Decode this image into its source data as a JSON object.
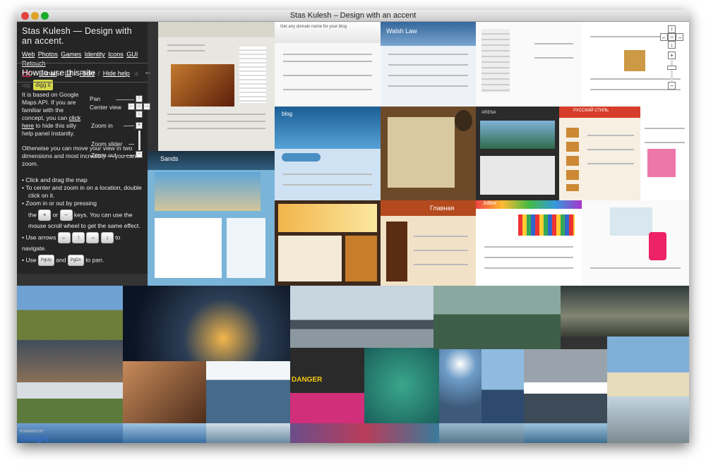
{
  "window": {
    "title": "Stas Kulesh – Design with an accent"
  },
  "panel": {
    "title": "Stas Kulesh — Design with an accent.",
    "links": [
      "Web",
      "Photos",
      "Games",
      "Identity",
      "Icons",
      "GUI",
      "Retouch"
    ],
    "links2": [
      "CV",
      "E-mail",
      "LJ",
      "Flickr",
      "Hide help"
    ],
    "seps": [
      "/",
      "/",
      "/",
      "/"
    ],
    "digg_label": "di ugg",
    "digg_button": "digg it",
    "how_title": "How to use this site",
    "how_close": "←",
    "intro_text": "It is based on Google Maps API. If you are familiar with the concept, you can",
    "click_here": "click here",
    "intro_text_2": "to hide this silly help panel instantly.",
    "otherwise": "Otherwise you can move your view in two dimensions and most incredibly — you can zoom.",
    "labels": {
      "pan": "Pan",
      "center": "Center view",
      "zoom_in": "Zoom in",
      "zoom_slider": "Zoom slider",
      "zoom_out": "Zoom out"
    },
    "bullets": [
      "Click and drag the map",
      "To center and zoom in on a location, double click on it.",
      "Zoom in or out by pressing",
      "Use arrows",
      "Use"
    ],
    "zoom_tail": "keys. You can use the mouse scroll wheel to get the same effect.",
    "the_word": "the",
    "or_word": "or",
    "and_word": "and",
    "to_navigate": "to navigate.",
    "to_pan": "to pan.",
    "keys": {
      "plus": "+",
      "minus": "−",
      "left": "←",
      "up": "↑",
      "right": "→",
      "down": "↓",
      "pgup": "PgUp",
      "pgdn": "PgDn"
    }
  },
  "map_controls": {
    "up": "↑",
    "left": "←",
    "right": "→",
    "down": "↓",
    "center": "○",
    "zoom_in": "+",
    "zoom_out": "−"
  },
  "tiles": {
    "t1": "Sands",
    "t2": "blog",
    "t3": "Walsh Law",
    "t4": "РУССКИЙ СТИЛЬ",
    "t5": "Get any domain name for your blog",
    "t6": "ARENA",
    "t7": "Главная",
    "t8": "JoBox",
    "t9": "DANGER"
  },
  "google": "Google",
  "google_powered": "POWERED BY"
}
